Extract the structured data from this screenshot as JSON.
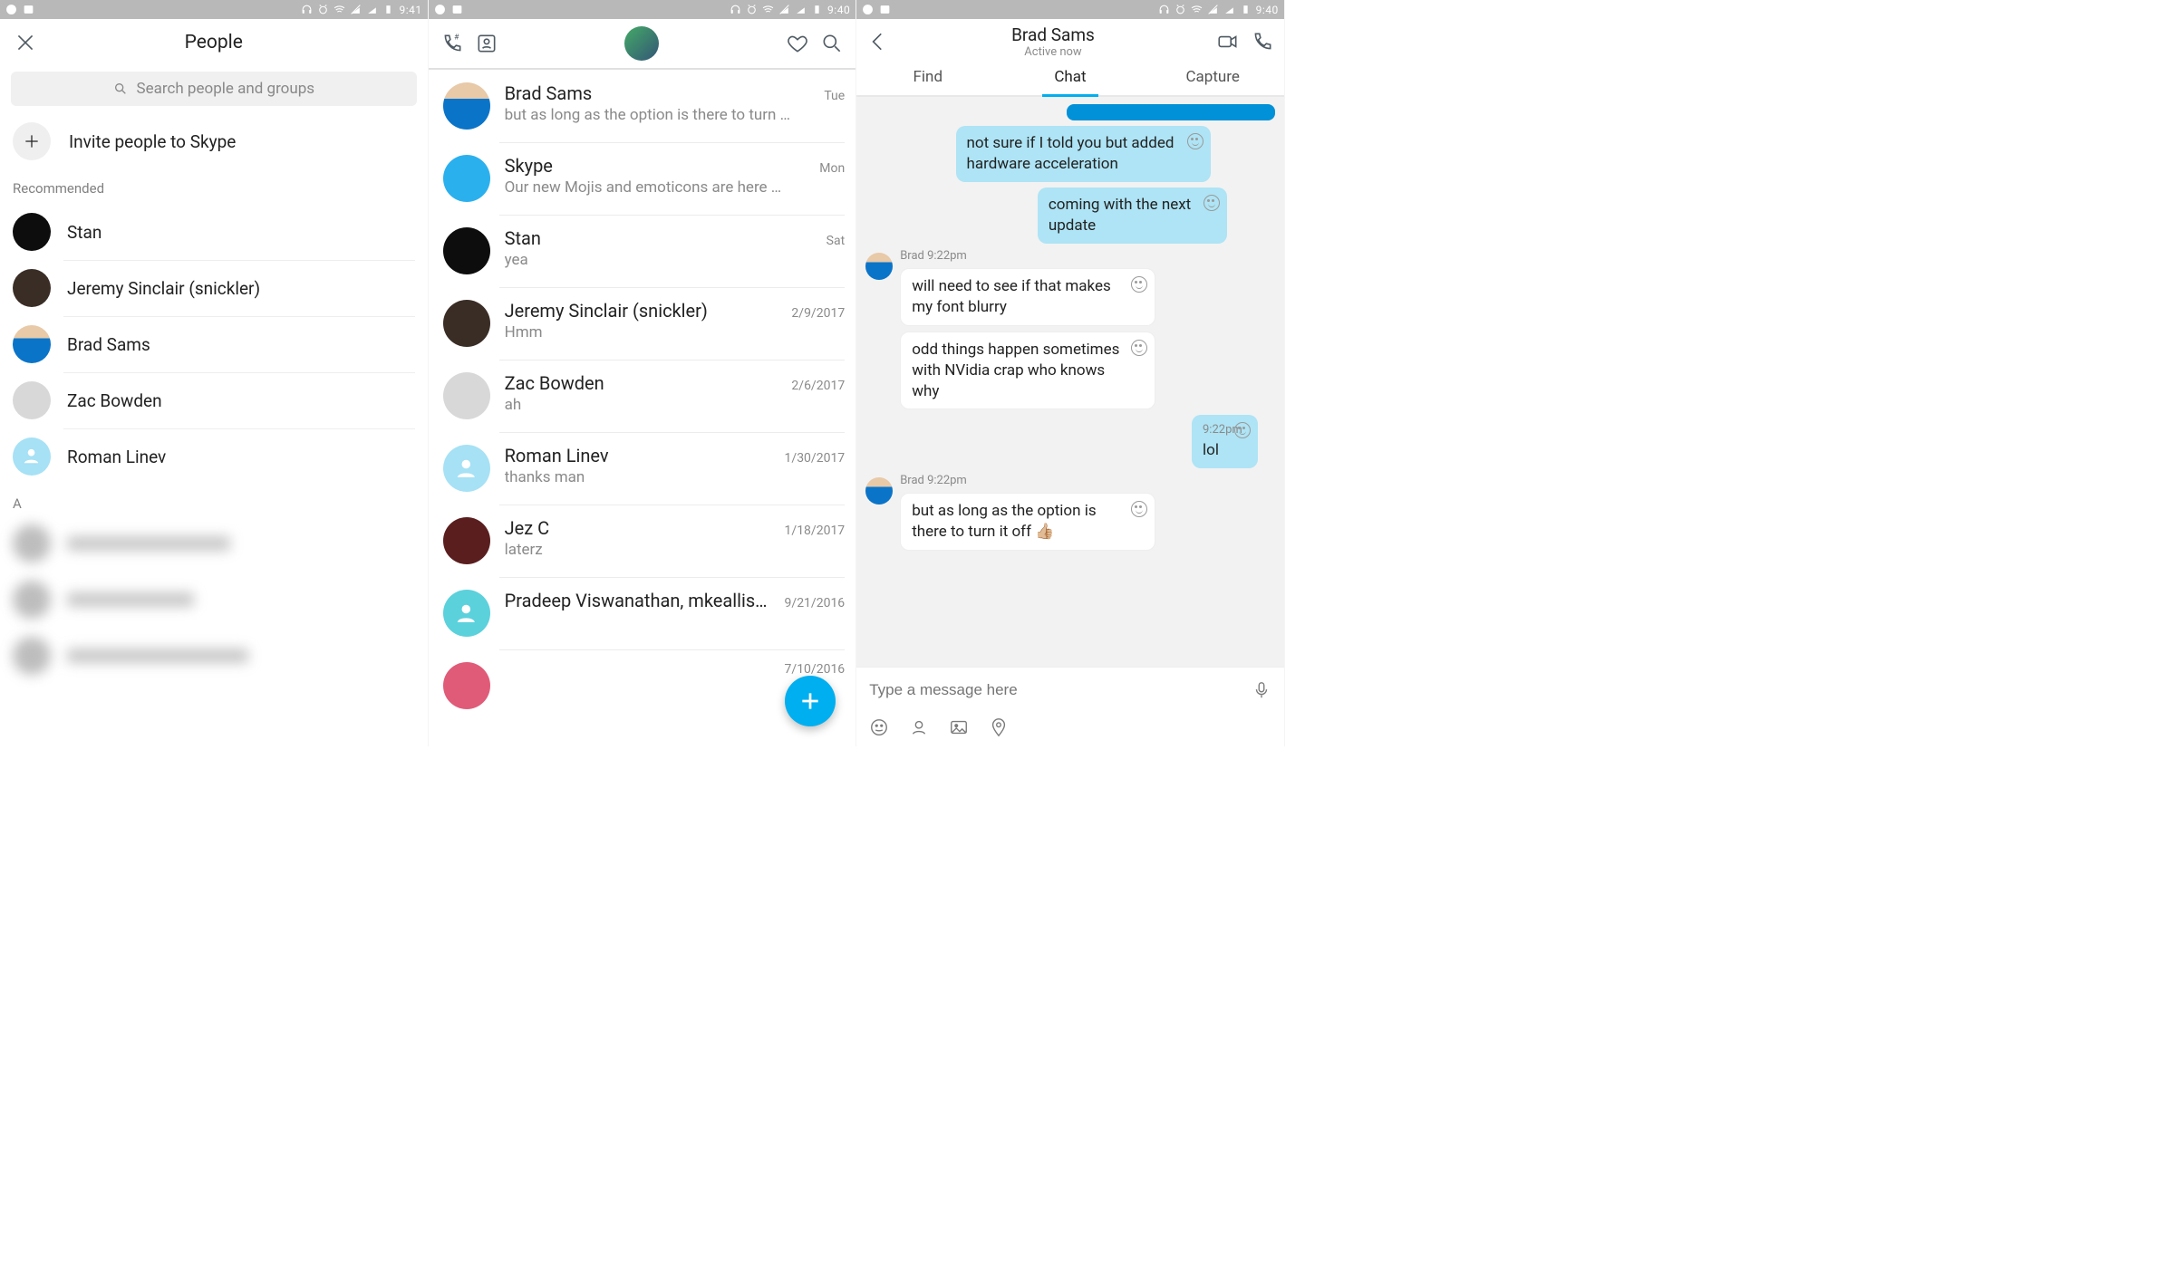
{
  "status": {
    "time1": "9:41",
    "time2": "9:40",
    "time3": "9:40"
  },
  "screen1": {
    "title": "People",
    "search_placeholder": "Search people and groups",
    "invite_label": "Invite people to Skype",
    "recommended_label": "Recommended",
    "alpha_label": "A",
    "recommended": [
      {
        "name": "Stan",
        "avatar": "av-black"
      },
      {
        "name": "Jeremy Sinclair (snickler)",
        "avatar": "av-jeremy"
      },
      {
        "name": "Brad Sams",
        "avatar": "av-brad"
      },
      {
        "name": "Zac Bowden",
        "avatar": "av-zac"
      },
      {
        "name": "Roman Linev",
        "avatar": "av-ltblue generic-person"
      }
    ]
  },
  "screen2": {
    "chats": [
      {
        "name": "Brad Sams",
        "preview": "but as long as the option is there to turn …",
        "time": "Tue",
        "avatar": "av-brad"
      },
      {
        "name": "Skype",
        "preview": "Our new Mojis and emoticons are here …",
        "time": "Mon",
        "avatar": "av-skype"
      },
      {
        "name": "Stan",
        "preview": "yea",
        "time": "Sat",
        "avatar": "av-black"
      },
      {
        "name": "Jeremy Sinclair (snickler)",
        "preview": "Hmm",
        "time": "2/9/2017",
        "avatar": "av-jeremy"
      },
      {
        "name": "Zac Bowden",
        "preview": "ah",
        "time": "2/6/2017",
        "avatar": "av-zac"
      },
      {
        "name": "Roman Linev",
        "preview": "thanks man",
        "time": "1/30/2017",
        "avatar": "av-ltblue generic-person"
      },
      {
        "name": "Jez C",
        "preview": "laterz",
        "time": "1/18/2017",
        "avatar": "av-jez"
      },
      {
        "name": "Pradeep Viswanathan, mkeallis…",
        "preview": "",
        "time": "9/21/2016",
        "avatar": "av-teal generic-person"
      },
      {
        "name": "",
        "preview": "",
        "time": "7/10/2016",
        "avatar": "av-pink"
      }
    ]
  },
  "screen3": {
    "title": "Brad Sams",
    "subtitle": "Active now",
    "tabs": {
      "find": "Find",
      "chat": "Chat",
      "capture": "Capture"
    },
    "messages": [
      {
        "dir": "out",
        "text": "not sure if I told you but added hardware acceleration"
      },
      {
        "dir": "out",
        "text": "coming with the next update"
      },
      {
        "dir": "in",
        "sender": "Brad 9:22pm",
        "text": "will need to see if that makes my font blurry"
      },
      {
        "dir": "in",
        "text": "odd things happen sometimes with NVidia crap who knows why"
      },
      {
        "dir": "out",
        "time": "9:22pm",
        "text": "lol"
      },
      {
        "dir": "in",
        "sender": "Brad 9:22pm",
        "text": "but as long as the option is there to turn it off 👍🏼"
      }
    ],
    "composer_placeholder": "Type a message here"
  }
}
